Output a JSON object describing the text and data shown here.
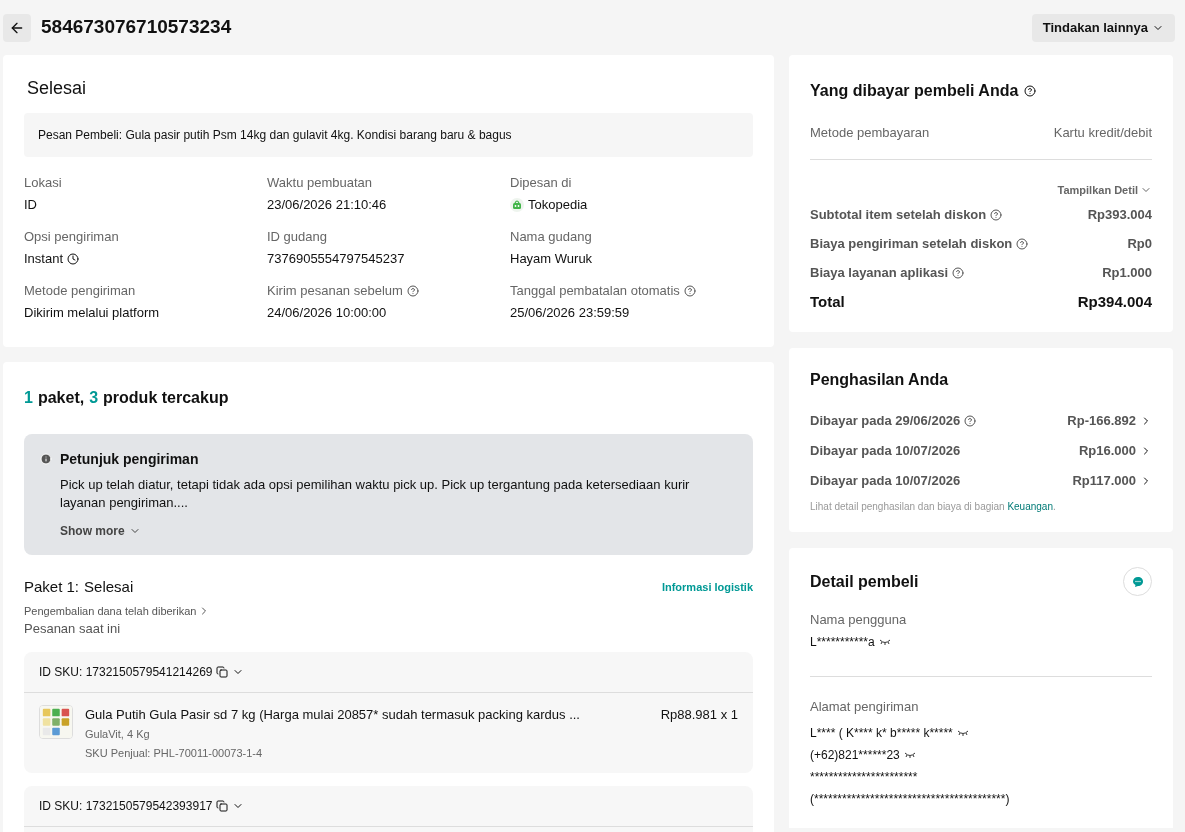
{
  "header": {
    "order_id": "584673076710573234",
    "more_actions": "Tindakan lainnya"
  },
  "status_card": {
    "status": "Selesai",
    "buyer_message": "Pesan Pembeli: Gula pasir putih Psm 14kg dan gulavit 4kg. Kondisi barang baru & bagus",
    "fields": [
      {
        "label": "Lokasi",
        "value": "ID",
        "kind": "plain",
        "help": false
      },
      {
        "label": "Waktu pembuatan",
        "value": "23/06/2026 21:10:46",
        "kind": "plain",
        "help": false
      },
      {
        "label": "Dipesan di",
        "value": "Tokopedia",
        "kind": "store",
        "help": false
      },
      {
        "label": "Opsi pengiriman",
        "value": "Instant",
        "kind": "clock",
        "help": false
      },
      {
        "label": "ID gudang",
        "value": "7376905554797545237",
        "kind": "plain",
        "help": false
      },
      {
        "label": "Nama gudang",
        "value": "Hayam Wuruk",
        "kind": "plain",
        "help": false
      },
      {
        "label": "Metode pengiriman",
        "value": "Dikirim melalui platform",
        "kind": "plain",
        "help": false
      },
      {
        "label": "Kirim pesanan sebelum",
        "value": "24/06/2026 10:00:00",
        "kind": "plain",
        "help": true
      },
      {
        "label": "Tanggal pembatalan otomatis",
        "value": "25/06/2026 23:59:59",
        "kind": "plain",
        "help": true
      }
    ]
  },
  "package_card": {
    "package_count": "1",
    "package_word": "paket,",
    "product_count": "3",
    "product_word": "produk tercakup",
    "notice": {
      "title": "Petunjuk pengiriman",
      "text": "Pick up telah diatur, tetapi tidak ada opsi pemilihan waktu pick up. Pick up tergantung pada ketersediaan kurir layanan pengiriman....",
      "show_more": "Show more"
    },
    "package_label": "Paket 1:",
    "package_status": "Selesai",
    "logistics_link": "Informasi logistik",
    "refund_link": "Pengembalian dana telah diberikan",
    "current_order": "Pesanan saat ini",
    "skus": [
      {
        "sku_id": "ID SKU: 1732150579541214269",
        "product": {
          "name": "Gula Putih Gula Pasir sd 7 kg (Harga mulai 20857* sudah termasuk packing kardus ...",
          "variant": "GulaVit, 4 Kg",
          "seller_sku": "SKU Penjual: PHL-70011-00073-1-4",
          "price": "Rp88.981 x 1"
        }
      },
      {
        "sku_id": "ID SKU: 1732150579542393917"
      }
    ]
  },
  "payment_card": {
    "title": "Yang dibayar pembeli Anda",
    "method_label": "Metode pembayaran",
    "method_value": "Kartu kredit/debit",
    "details_toggle": "Tampilkan Detil",
    "rows": [
      {
        "label": "Subtotal item setelah diskon",
        "value": "Rp393.004",
        "help": true
      },
      {
        "label": "Biaya pengiriman setelah diskon",
        "value": "Rp0",
        "help": true
      },
      {
        "label": "Biaya layanan aplikasi",
        "value": "Rp1.000",
        "help": true
      }
    ],
    "total_label": "Total",
    "total_value": "Rp394.004"
  },
  "earnings_card": {
    "title": "Penghasilan Anda",
    "rows": [
      {
        "label": "Dibayar pada 29/06/2026",
        "value": "Rp-166.892",
        "help": true
      },
      {
        "label": "Dibayar pada 10/07/2026",
        "value": "Rp16.000",
        "help": false
      },
      {
        "label": "Dibayar pada 10/07/2026",
        "value": "Rp117.000",
        "help": false
      }
    ],
    "note": "Lihat detail penghasilan dan biaya di bagian",
    "note_link": "Keuangan",
    "note_end": "."
  },
  "buyer_card": {
    "title": "Detail pembeli",
    "username_label": "Nama pengguna",
    "username": "L***********a",
    "address_label": "Alamat pengiriman",
    "address_lines": [
      "L**** ( K**** k* b***** k*****",
      "(+62)821******23",
      "***********************",
      "(*****************************************)"
    ],
    "masked": [
      true,
      true,
      true,
      false,
      false
    ]
  }
}
